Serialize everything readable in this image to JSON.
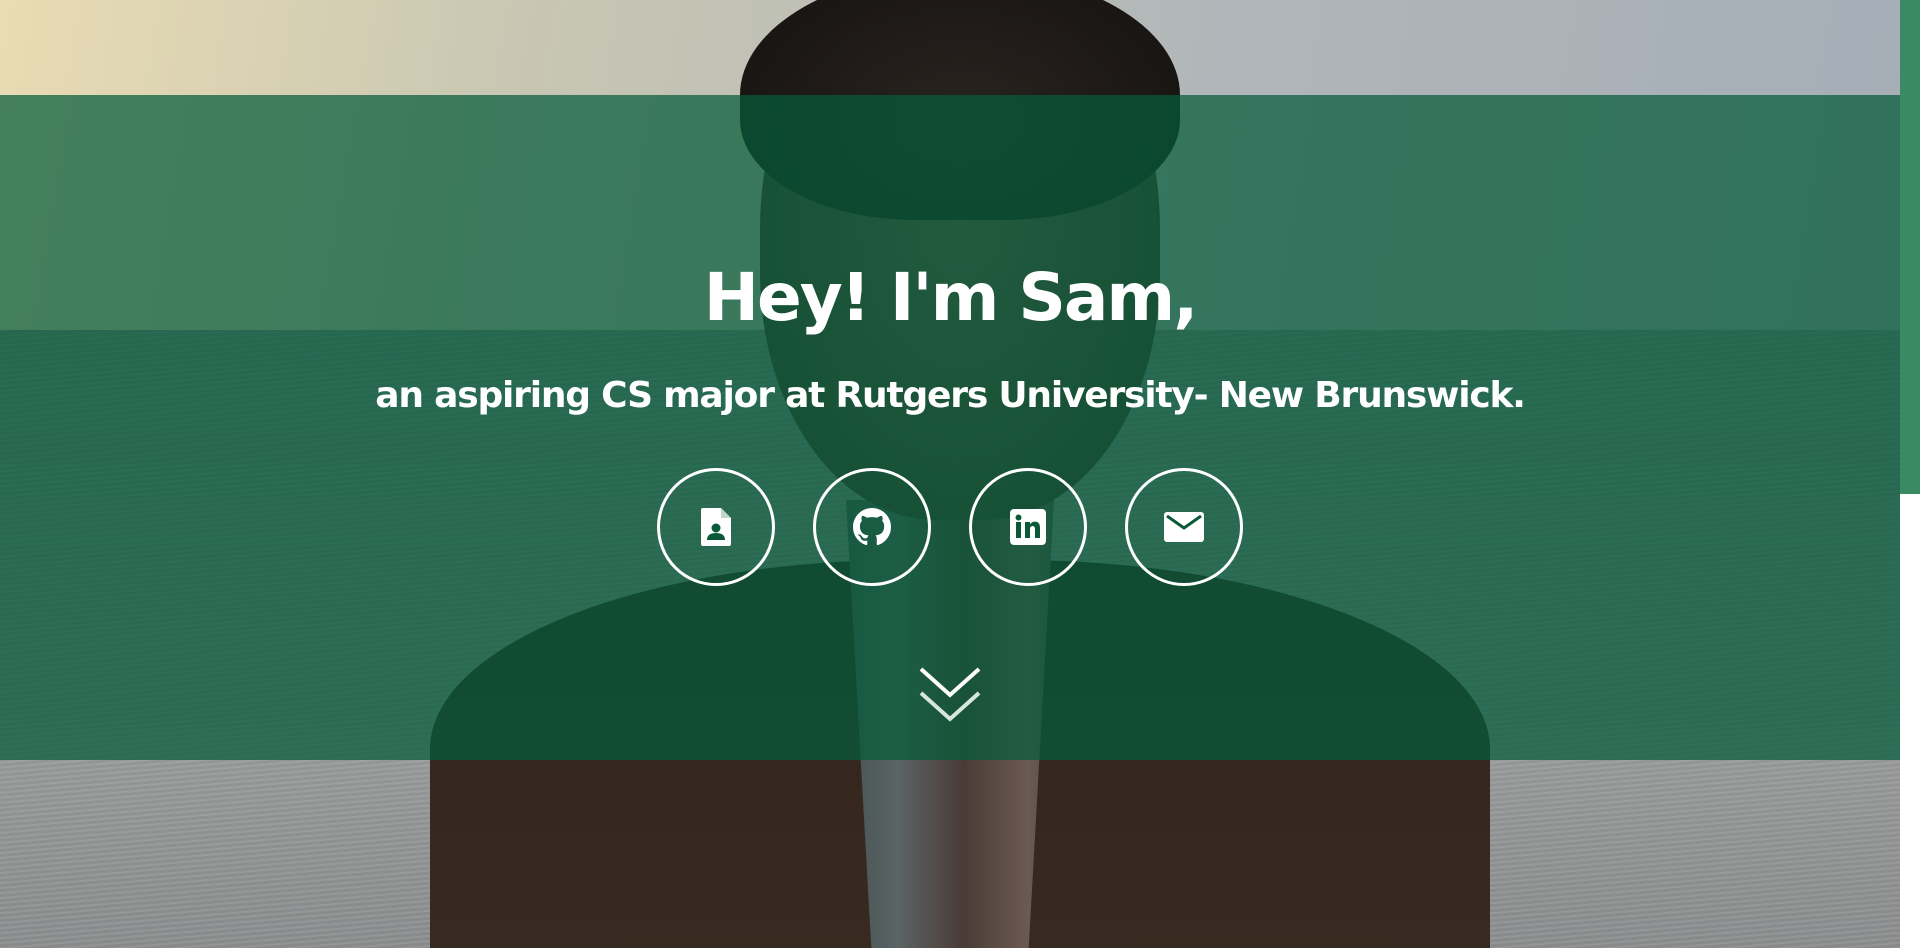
{
  "hero": {
    "title": "Hey! I'm Sam,",
    "subtitle": "an aspiring CS major at Rutgers University- New Brunswick."
  },
  "links": [
    {
      "name": "resume",
      "icon": "resume-document-icon"
    },
    {
      "name": "github",
      "icon": "github-icon"
    },
    {
      "name": "linkedin",
      "icon": "linkedin-icon"
    },
    {
      "name": "email",
      "icon": "email-icon"
    }
  ],
  "colors": {
    "overlay": "#065c3a",
    "text": "#ffffff",
    "scrollbar_thumb": "#3a8a64"
  },
  "scroll_icon": "double-chevron-down-icon"
}
